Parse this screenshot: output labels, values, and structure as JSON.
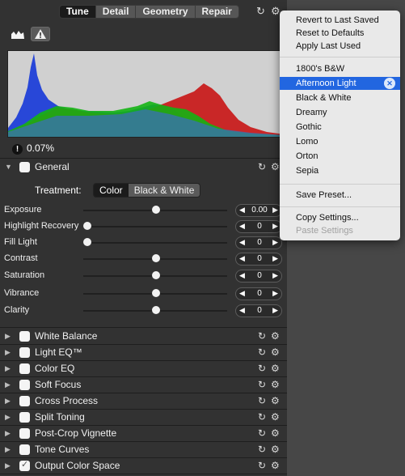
{
  "tabs": [
    "Tune",
    "Detail",
    "Geometry",
    "Repair"
  ],
  "clipping": {
    "value": "0.07%"
  },
  "general": {
    "title": "General",
    "treatment_label": "Treatment:",
    "treatment_options": [
      "Color",
      "Black & White"
    ],
    "treatment_selected": "Color"
  },
  "sliders": [
    {
      "label": "Exposure",
      "value": "0.00",
      "level": 0.5
    },
    {
      "label": "Highlight Recovery",
      "value": "0",
      "level": 0.0
    },
    {
      "label": "Fill Light",
      "value": "0",
      "level": 0.0
    },
    {
      "label": "Contrast",
      "value": "0",
      "level": 0.5
    },
    {
      "label": "Saturation",
      "value": "0",
      "level": 0.5
    },
    {
      "label": "Vibrance",
      "value": "0",
      "level": 0.5
    },
    {
      "label": "Clarity",
      "value": "0",
      "level": 0.5
    }
  ],
  "sections": [
    {
      "label": "White Balance",
      "checked": false
    },
    {
      "label": "Light EQ™",
      "checked": false
    },
    {
      "label": "Color EQ",
      "checked": false
    },
    {
      "label": "Soft Focus",
      "checked": false
    },
    {
      "label": "Cross Process",
      "checked": false
    },
    {
      "label": "Split Toning",
      "checked": false
    },
    {
      "label": "Post-Crop Vignette",
      "checked": false
    },
    {
      "label": "Tone Curves",
      "checked": false
    },
    {
      "label": "Output Color Space",
      "checked": true
    }
  ],
  "menu": {
    "group1": [
      "Revert to Last Saved",
      "Reset to Defaults",
      "Apply Last Used"
    ],
    "presets": [
      "1800's B&W",
      "Afternoon Light",
      "Black & White",
      "Dreamy",
      "Gothic",
      "Lomo",
      "Orton",
      "Sepia"
    ],
    "selected_preset": "Afternoon Light",
    "save_preset": "Save Preset...",
    "copy_settings": "Copy Settings...",
    "paste_settings": "Paste Settings"
  },
  "colors": {
    "menu_highlight": "#2266e0",
    "hist_blue": "#1f3fd8",
    "hist_red": "#c81414",
    "hist_green": "#14b414"
  }
}
